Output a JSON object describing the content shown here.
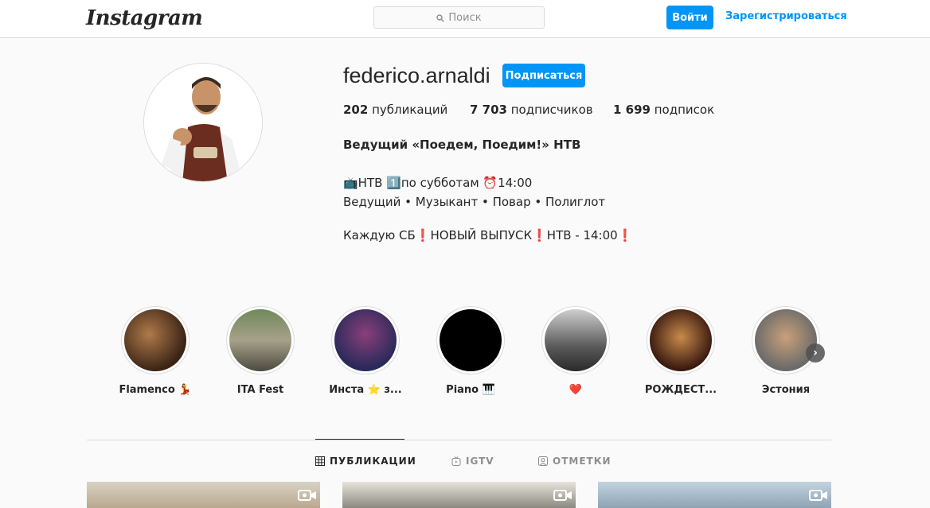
{
  "header": {
    "logo": "Instagram",
    "search_placeholder": "Поиск",
    "login_label": "Войти",
    "signup_label": "Зарегистрироваться"
  },
  "profile": {
    "username": "federico.arnaldi",
    "follow_label": "Подписаться",
    "posts_count": "202",
    "posts_label": " публикаций",
    "followers_count": "7 703",
    "followers_label": " подписчиков",
    "following_count": "1 699",
    "following_label": " подписок",
    "full_name": "Ведущий «Поедем, Поедим!» НТВ",
    "bio_line1": "📺НТВ 1️⃣по субботам ⏰14:00",
    "bio_line2": "Ведущий • Музыкант • Повар • Полиглот",
    "bio_line3": "Каждую СБ❗НОВЫЙ ВЫПУСК❗НТВ - 14:00❗"
  },
  "highlights": [
    {
      "label": "Flamenco 💃"
    },
    {
      "label": "ITA Fest"
    },
    {
      "label": "Инста ⭐ з..."
    },
    {
      "label": "Piano 🎹"
    },
    {
      "label": "❤️"
    },
    {
      "label": "РОЖДЕСТ..."
    },
    {
      "label": "Эстония"
    }
  ],
  "tabs": {
    "posts": "ПУБЛИКАЦИИ",
    "igtv": "IGTV",
    "tagged": "ОТМЕТКИ"
  },
  "colors": {
    "accent": "#0095f6",
    "text": "#262626",
    "muted": "#8e8e8e",
    "border": "#dbdbdb",
    "background": "#fafafa"
  },
  "icons": [
    "search-icon",
    "chevron-right-icon",
    "grid-icon",
    "igtv-icon",
    "tagged-icon",
    "video-icon"
  ]
}
